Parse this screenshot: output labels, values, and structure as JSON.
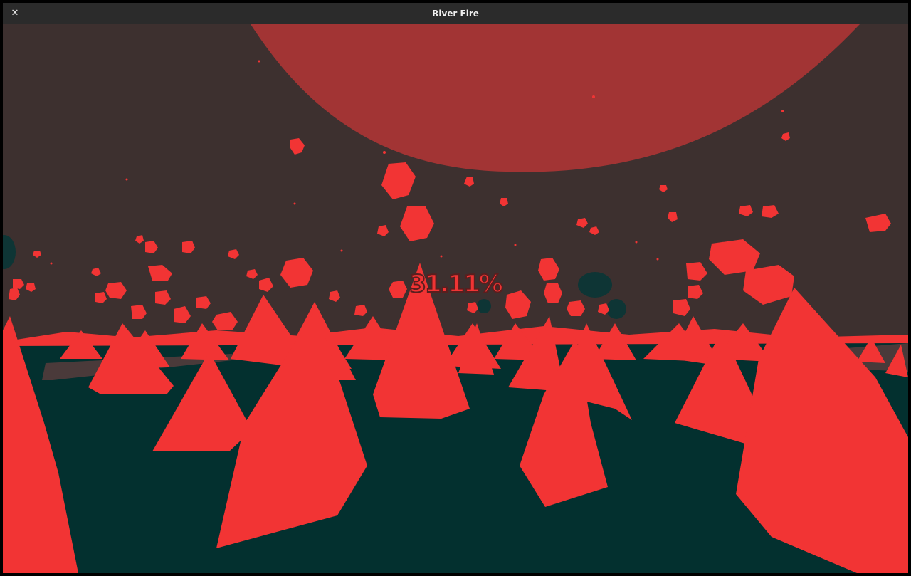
{
  "window": {
    "title": "River Fire",
    "close_glyph": "✕",
    "close_icon": "close-icon"
  },
  "hud": {
    "progress_text": "31.11%"
  },
  "colors": {
    "sky": "#3d302f",
    "sun": "#a23434",
    "ground": "#03302f",
    "fire": "#f23434",
    "ember": "#f23434",
    "burnt_tree": "#0e3535",
    "river_band": "#4a3a3a"
  }
}
